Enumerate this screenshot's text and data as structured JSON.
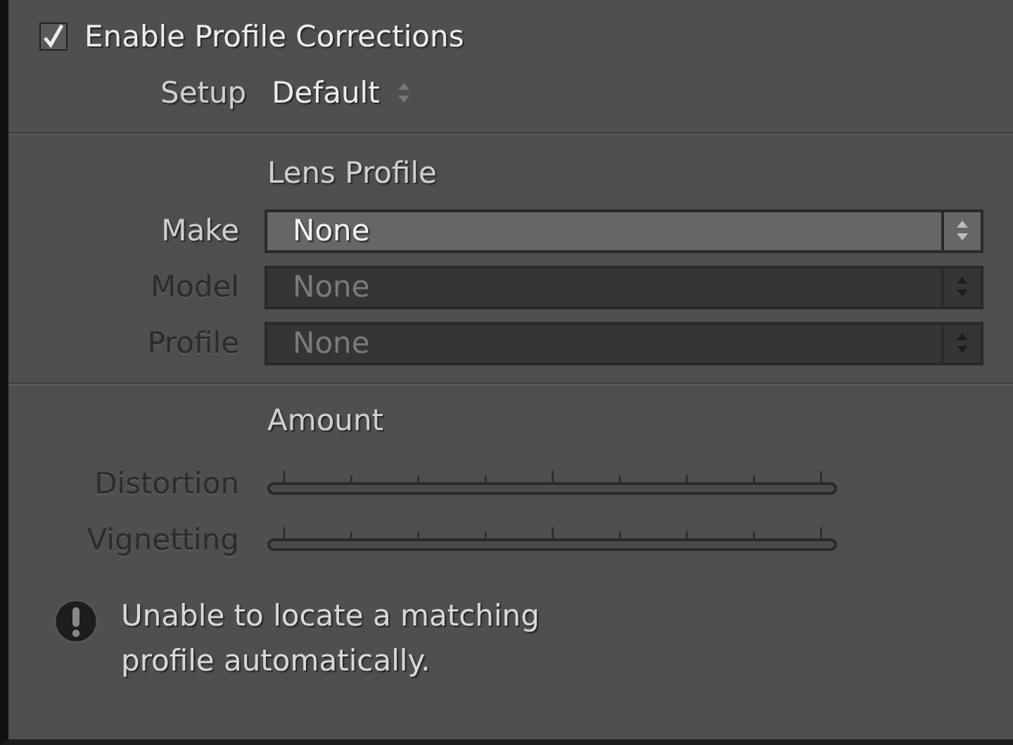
{
  "enable_profile_corrections": {
    "label": "Enable Profile Corrections",
    "checked": true
  },
  "setup": {
    "label": "Setup",
    "value": "Default"
  },
  "lens_profile": {
    "heading": "Lens Profile",
    "fields": [
      {
        "label": "Make",
        "value": "None",
        "disabled": false
      },
      {
        "label": "Model",
        "value": "None",
        "disabled": true
      },
      {
        "label": "Profile",
        "value": "None",
        "disabled": true
      }
    ]
  },
  "amount": {
    "heading": "Amount",
    "sliders": [
      {
        "label": "Distortion",
        "disabled": true
      },
      {
        "label": "Vignetting",
        "disabled": true
      }
    ]
  },
  "message": {
    "text": "Unable to locate a matching profile automatically."
  }
}
